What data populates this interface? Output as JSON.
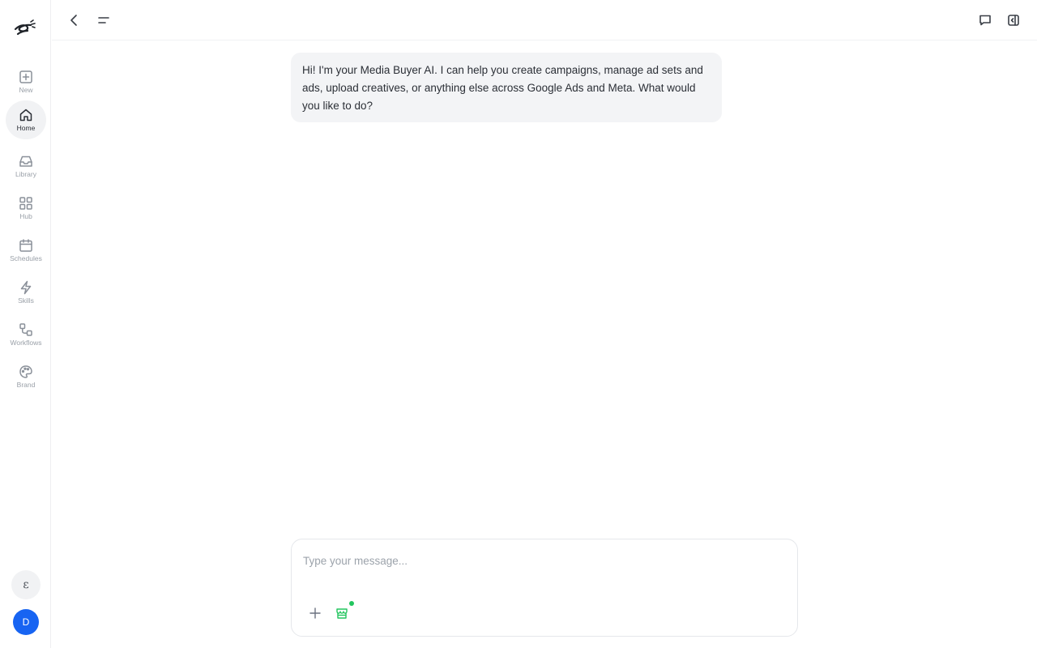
{
  "sidebar": {
    "items": [
      {
        "label": "New",
        "icon": "plus-square-icon"
      },
      {
        "label": "Home",
        "icon": "home-icon",
        "active": true
      },
      {
        "label": "Library",
        "icon": "inbox-icon"
      },
      {
        "label": "Hub",
        "icon": "grid-icon"
      },
      {
        "label": "Schedules",
        "icon": "calendar-icon"
      },
      {
        "label": "Skills",
        "icon": "lightning-icon"
      },
      {
        "label": "Workflows",
        "icon": "workflow-icon"
      },
      {
        "label": "Brand",
        "icon": "palette-icon"
      }
    ],
    "bottom_glyph": "ε",
    "avatar_initial": "D"
  },
  "chat": {
    "messages": [
      {
        "role": "assistant",
        "text": "Hi! I'm your Media Buyer AI. I can help you create campaigns, manage ad sets and ads, upload creatives, or anything else across Google Ads and Meta. What would you like to do?"
      }
    ]
  },
  "composer": {
    "placeholder": "Type your message...",
    "value": ""
  },
  "colors": {
    "accent_green": "#22c55e",
    "avatar_blue": "#1764f2",
    "bubble_bg": "#f3f4f6"
  }
}
